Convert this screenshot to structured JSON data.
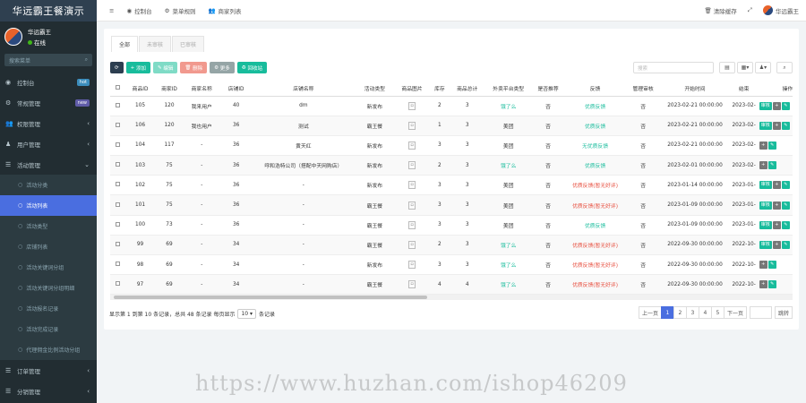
{
  "brand": "华远霸王餐演示",
  "user": {
    "name": "华远霸王",
    "status": "在线"
  },
  "sidebar": {
    "search_placeholder": "搜索菜单",
    "items": [
      {
        "label": "控制台",
        "icon": "dashboard-icon",
        "badge": "hot",
        "badge_color": "#3c8dbc"
      },
      {
        "label": "常规管理",
        "icon": "gear-icon",
        "badge": "new",
        "badge_color": "#605ca8"
      },
      {
        "label": "权限管理",
        "icon": "group-icon",
        "chev": "‹"
      },
      {
        "label": "用户管理",
        "icon": "user-icon",
        "chev": "‹"
      },
      {
        "label": "活动管理",
        "icon": "list-icon",
        "chev": "⌄"
      }
    ],
    "subs": [
      "活动分类",
      "活动列表",
      "活动类型",
      "店铺列表",
      "活动关键词分组",
      "活动关键词分组明细",
      "活动报名记录",
      "活动完成记录",
      "代理佣金比例活动分组"
    ],
    "bottom": [
      {
        "label": "订单管理",
        "chev": "‹"
      },
      {
        "label": "分销管理",
        "chev": "‹"
      }
    ]
  },
  "topnav": [
    {
      "icon": "dashboard-icon",
      "label": "控制台"
    },
    {
      "icon": "gear-icon",
      "label": "菜单规则"
    },
    {
      "icon": "group-icon",
      "label": "商家列表"
    }
  ],
  "topright": {
    "clear": "清除缓存",
    "user": "华远霸王"
  },
  "tabs": [
    "全部",
    "未审核",
    "已审核"
  ],
  "toolbar": {
    "add": "添加",
    "edit": "编辑",
    "del": "删除",
    "more": "更多",
    "recycle": "回收站"
  },
  "table_search_placeholder": "搜索",
  "columns": [
    "",
    "商品ID",
    "商家ID",
    "商家名称",
    "店铺ID",
    "店铺名称",
    "活动类型",
    "商品图片",
    "库存",
    "商品总计",
    "外卖平台类型",
    "是否推荐",
    "反馈",
    "管理审核",
    "开始时间",
    "结束",
    "操作"
  ],
  "rows": [
    [
      "105",
      "120",
      "我来用户",
      "40",
      "dm",
      "新发布",
      "",
      "2",
      "3",
      "饿了么",
      "否",
      "优质反馈",
      "否",
      "2023-02-21 00:00:00",
      "2023-02-"
    ],
    [
      "106",
      "120",
      "我也用户",
      "36",
      "测试",
      "霸王餐",
      "",
      "1",
      "3",
      "美团",
      "否",
      "优质反馈",
      "否",
      "2023-02-21 00:00:00",
      "2023-02-"
    ],
    [
      "104",
      "117",
      "-",
      "36",
      "黄天红",
      "新发布",
      "",
      "3",
      "3",
      "美团",
      "否",
      "无优质反馈",
      "否",
      "2023-02-21 00:00:00",
      "2023-02-"
    ],
    [
      "103",
      "75",
      "-",
      "36",
      "呼和浩特公司（搭配中天网购店）",
      "新发布",
      "",
      "2",
      "3",
      "饿了么",
      "否",
      "优质反馈",
      "否",
      "2023-02-01 00:00:00",
      "2023-02-"
    ],
    [
      "102",
      "75",
      "-",
      "36",
      "-",
      "新发布",
      "",
      "3",
      "3",
      "美团",
      "否",
      "优质反馈(暂无好评)",
      "否",
      "2023-01-14 00:00:00",
      "2023-01-"
    ],
    [
      "101",
      "75",
      "-",
      "36",
      "-",
      "霸王餐",
      "",
      "3",
      "3",
      "美团",
      "否",
      "优质反馈(暂无好评)",
      "否",
      "2023-01-09 00:00:00",
      "2023-01-"
    ],
    [
      "100",
      "73",
      "-",
      "36",
      "-",
      "霸王餐",
      "",
      "3",
      "3",
      "美团",
      "否",
      "优质反馈",
      "否",
      "2023-01-09 00:00:00",
      "2023-01-"
    ],
    [
      "99",
      "69",
      "-",
      "34",
      "-",
      "霸王餐",
      "",
      "2",
      "3",
      "饿了么",
      "否",
      "优质反馈(暂无好评)",
      "否",
      "2022-09-30 00:00:00",
      "2022-10-"
    ],
    [
      "98",
      "69",
      "-",
      "34",
      "-",
      "新发布",
      "",
      "3",
      "3",
      "饿了么",
      "否",
      "优质反馈(暂无好评)",
      "否",
      "2022-09-30 00:00:00",
      "2022-10-"
    ],
    [
      "97",
      "69",
      "-",
      "34",
      "-",
      "霸王餐",
      "",
      "4",
      "4",
      "饿了么",
      "否",
      "优质反馈(暂无好评)",
      "否",
      "2022-09-30 00:00:00",
      "2022-10-"
    ]
  ],
  "row_ops": [
    [
      "审核",
      "+",
      "✎"
    ],
    [
      "审核",
      "+",
      "✎"
    ],
    [
      "+",
      "✎"
    ],
    [
      "+",
      "✎"
    ],
    [
      "审核",
      "+",
      "✎"
    ],
    [
      "审核",
      "+",
      "✎"
    ],
    [
      "审核",
      "+",
      "✎"
    ],
    [
      "审核",
      "+",
      "✎"
    ],
    [
      "+",
      "✎"
    ],
    [
      "+",
      "✎"
    ]
  ],
  "bad_feedback_rows": [
    4,
    5,
    7,
    8,
    9
  ],
  "pagination": {
    "info_pre": "显示第 1 到第 10 条记录，总共 48 条记录 每页显示",
    "page_size": "10",
    "info_post": "条记录",
    "prev": "上一页",
    "pages": [
      "1",
      "2",
      "3",
      "4",
      "5"
    ],
    "next": "下一页",
    "go": "跳转",
    "current": 0
  },
  "watermark": "https://www.huzhan.com/ishop46209",
  "colors": {
    "accent": "#4a6ee0",
    "sidebar": "#222d32",
    "success": "#18bc9c",
    "danger": "#e74c3c"
  }
}
